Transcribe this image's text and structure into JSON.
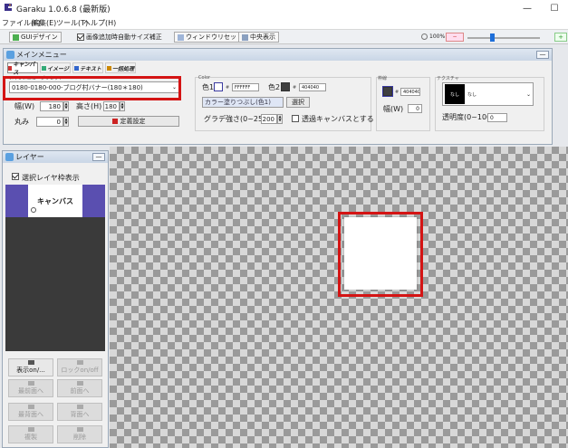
{
  "window": {
    "title": "Garaku 1.0.6.8 (最新版)",
    "minimize": "—",
    "maximize": "☐"
  },
  "menubar": [
    "ファイル(F)",
    "編集(E)",
    "ツール(T)",
    "ヘルプ(H)"
  ],
  "toolbar": {
    "gui_design": "GUIデザイン",
    "auto_resize": "画像追加時自動サイズ補正",
    "window_reset": "ウィンドウリセット",
    "center_view": "中央表示",
    "zoom": "100%"
  },
  "main_menu": {
    "title": "メインメニュー",
    "tabs": [
      "キャンバス",
      "イメージ",
      "テキスト",
      "一括処理"
    ],
    "preset_label": "メインメニュープリセット",
    "preset_value": "0180-0180-000-ブログ村バナー(180＊180)",
    "width_label": "幅(W)",
    "width_value": "180",
    "height_label": "高さ(H)",
    "height_value": "180",
    "round_label": "丸み",
    "round_value": "0",
    "fixed_button": "定義設定",
    "color_section": "Color",
    "color1_label": "色1",
    "color1_hex": "FFFFFF",
    "color2_label": "色2",
    "color2_hex": "404040",
    "fill_value": "カラー塗りつぶし(色1)",
    "select_button": "選択",
    "gradient_label": "グラデ強さ(0~255)",
    "gradient_value": "200",
    "transparent_label": "透過キャンバスとする",
    "border_section": "枠線",
    "border_hex": "404040",
    "border_width_label": "幅(W)",
    "border_width_value": "0",
    "texture_section": "テクスチャ",
    "texture_value": "なし",
    "texture_thumb": "なし",
    "opacity_label": "透明度(0~100)",
    "opacity_value": "0"
  },
  "layers": {
    "title": "レイヤー",
    "show_frame": "選択レイヤ枠表示",
    "item_label": "キャンバス",
    "buttons": [
      {
        "label": "表示on/...",
        "active": true
      },
      {
        "label": "ロックon/off",
        "active": false
      },
      {
        "label": "最前面へ",
        "active": false
      },
      {
        "label": "前面へ",
        "active": false
      },
      {
        "label": "最背面へ",
        "active": false
      },
      {
        "label": "背面へ",
        "active": false
      },
      {
        "label": "複製",
        "active": false
      },
      {
        "label": "削除",
        "active": false
      }
    ]
  },
  "colors": {
    "accent": "#5a4fb0",
    "highlight_red": "#d41414",
    "layer_panel_bg": "#3a3a3a"
  }
}
